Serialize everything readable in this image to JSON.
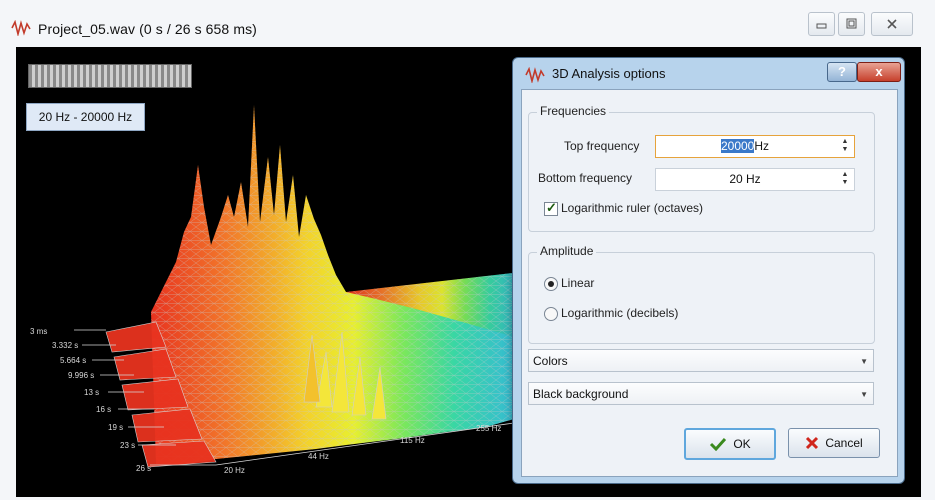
{
  "window": {
    "title": "Project_05.wav (0 s / 26 s 658 ms)",
    "controls": [
      "minimize-icon",
      "maximize-icon",
      "close-icon"
    ]
  },
  "visualizer": {
    "frequency_range": "20 Hz - 20000 Hz",
    "background_color": "#000000",
    "time_axis_labels": [
      "3 ms",
      "3.332 s",
      "5.664 s",
      "9.996 s",
      "13 s",
      "16 s",
      "19 s",
      "23 s",
      "26 s"
    ],
    "frequency_axis_labels": [
      "20 Hz",
      "44 Hz",
      "115 Hz",
      "255 Hz"
    ]
  },
  "dialog": {
    "title": "3D Analysis options",
    "help_label": "?",
    "close_label": "x",
    "frequencies": {
      "legend": "Frequencies",
      "top_label": "Top frequency",
      "top_value_selected": "20000",
      "top_value_unit": "Hz",
      "bottom_label": "Bottom frequency",
      "bottom_value": "20 Hz",
      "log_ruler_label": "Logarithmic ruler (octaves)",
      "log_ruler_checked": true
    },
    "amplitude": {
      "legend": "Amplitude",
      "options": [
        {
          "label": "Linear",
          "selected": true
        },
        {
          "label": "Logarithmic (decibels)",
          "selected": false
        }
      ]
    },
    "colors_select": "Colors",
    "background_select": "Black background",
    "ok_label": "OK",
    "cancel_label": "Cancel",
    "accent_color": "#5fa7dd",
    "cancel_icon_color": "#d0261c",
    "ok_icon_color": "#3a8a1e"
  }
}
